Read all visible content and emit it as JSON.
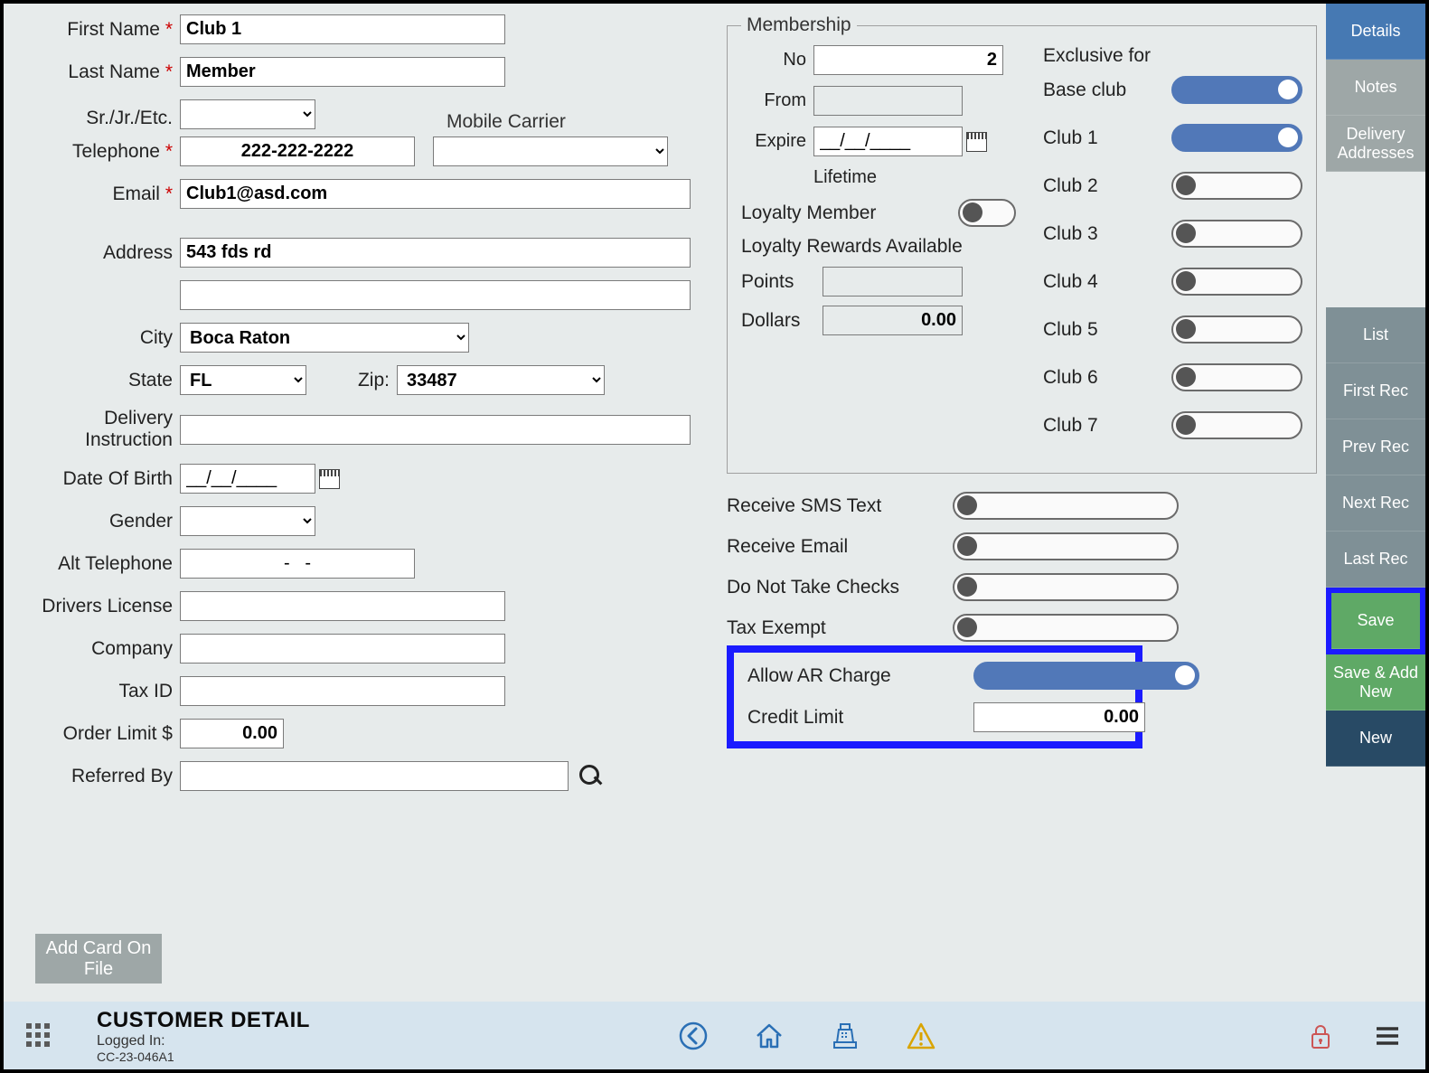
{
  "sidebar": {
    "details": "Details",
    "notes": "Notes",
    "delivery": "Delivery Addresses",
    "list": "List",
    "first": "First Rec",
    "prev": "Prev Rec",
    "next": "Next Rec",
    "last": "Last Rec",
    "save": "Save",
    "saveadd": "Save & Add New",
    "new": "New"
  },
  "labels": {
    "first_name": "First Name",
    "last_name": "Last Name",
    "suffix": "Sr./Jr./Etc.",
    "mobile_carrier": "Mobile Carrier",
    "telephone": "Telephone",
    "email": "Email",
    "address": "Address",
    "city": "City",
    "state": "State",
    "zip": "Zip:",
    "delivery_instruction": "Delivery Instruction",
    "dob": "Date Of Birth",
    "gender": "Gender",
    "alt_tel": "Alt Telephone",
    "drivers": "Drivers License",
    "company": "Company",
    "taxid": "Tax ID",
    "orderlimit": "Order Limit $",
    "referred": "Referred By",
    "add_card": "Add Card On File"
  },
  "values": {
    "first_name": "Club 1",
    "last_name": "Member",
    "suffix": "",
    "mobile_carrier": "",
    "telephone": "222-222-2222",
    "email": "Club1@asd.com",
    "address1": "543 fds rd",
    "address2": "",
    "city": "Boca Raton",
    "state": "FL",
    "zip": "33487",
    "delivery_instruction": "",
    "dob": "__/__/____",
    "gender": "",
    "alt_tel": "-   -",
    "drivers": "",
    "company": "",
    "taxid": "",
    "orderlimit": "0.00",
    "referred": ""
  },
  "membership": {
    "legend": "Membership",
    "no_label": "No",
    "no": "2",
    "from_label": "From",
    "from": "",
    "expire_label": "Expire",
    "expire": "__/__/____",
    "lifetime": "Lifetime",
    "loyalty_member": "Loyalty Member",
    "loyalty_member_on": false,
    "loyalty_rewards": "Loyalty Rewards Available",
    "points_label": "Points",
    "points": "",
    "dollars_label": "Dollars",
    "dollars": "0.00",
    "exclusive_for": "Exclusive for",
    "clubs": [
      {
        "label": "Base club",
        "on": true
      },
      {
        "label": "Club 1",
        "on": true
      },
      {
        "label": "Club 2",
        "on": false
      },
      {
        "label": "Club 3",
        "on": false
      },
      {
        "label": "Club 4",
        "on": false
      },
      {
        "label": "Club 5",
        "on": false
      },
      {
        "label": "Club 6",
        "on": false
      },
      {
        "label": "Club 7",
        "on": false
      }
    ]
  },
  "opts": {
    "sms": {
      "label": "Receive SMS Text",
      "on": false
    },
    "email": {
      "label": "Receive Email",
      "on": false
    },
    "nochecks": {
      "label": "Do Not Take Checks",
      "on": false
    },
    "taxexempt": {
      "label": "Tax Exempt",
      "on": false
    },
    "ar": {
      "label": "Allow AR Charge",
      "on": true
    },
    "credit": {
      "label": "Credit Limit",
      "value": "0.00"
    }
  },
  "footer": {
    "title": "CUSTOMER DETAIL",
    "logged_in": "Logged In:",
    "station": "CC-23-046A1"
  }
}
